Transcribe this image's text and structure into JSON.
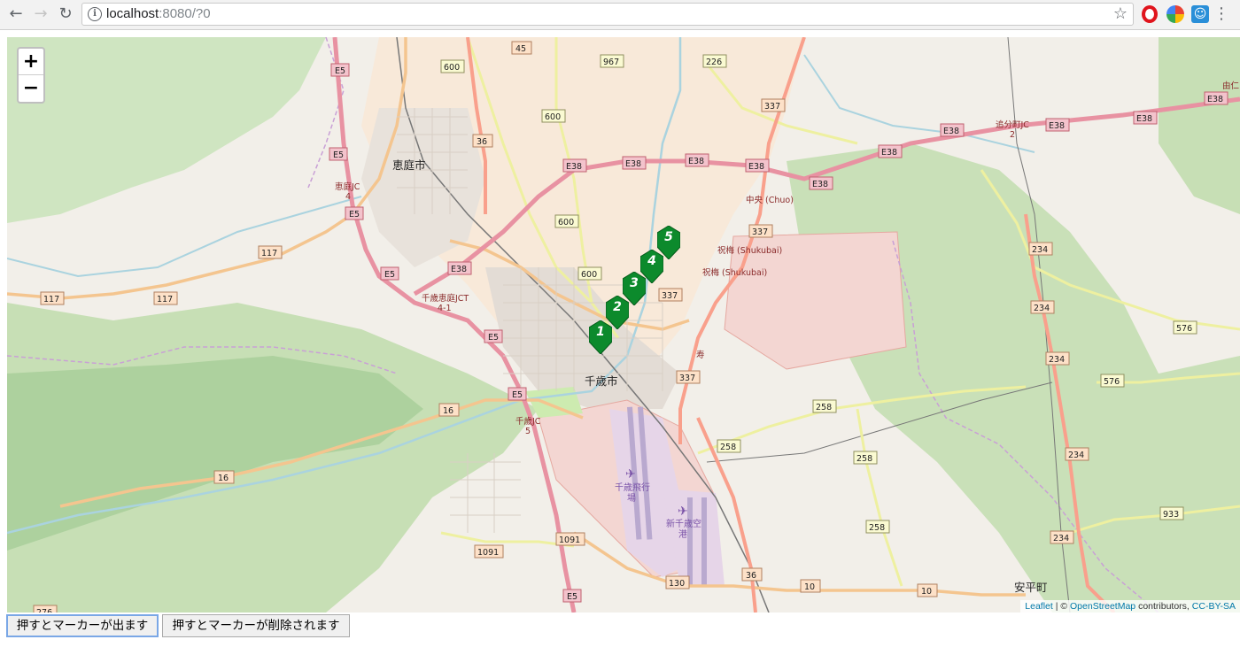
{
  "browser": {
    "url_host": "localhost",
    "url_rest": ":8080/?0",
    "icons": [
      "back-icon",
      "forward-icon",
      "reload-icon",
      "info-icon",
      "star-icon",
      "opera-icon",
      "extension-icon",
      "extension-blue-icon",
      "menu-icon"
    ],
    "back": "←",
    "forward": "→",
    "reload": "↻",
    "info": "i",
    "star": "☆",
    "menu": "⋮",
    "ext_blue": "☺"
  },
  "map": {
    "zoom_in": "+",
    "zoom_out": "−",
    "markers": [
      "1",
      "2",
      "3",
      "4",
      "5"
    ],
    "labels": {
      "eniwa": "恵庭市",
      "chitose": "千歳市",
      "abira": "安平町",
      "chuo": "中央 (Chuo)",
      "shukubai1": "祝梅 (Shukubai)",
      "shukubai2": "祝梅 (Shukubai)",
      "kotobuki": "寿",
      "eniwa_jc_1": "恵庭JC",
      "eniwa_jc_2": "4",
      "chitose_eniwa_jct_1": "千歳恵庭JCT",
      "chitose_eniwa_jct_2": "4-1",
      "chitose_jc_1": "千歳JC",
      "chitose_jc_2": "5",
      "oiwake_jc_1": "追分町JC",
      "oiwake_jc_2": "2",
      "airport1_1": "千歳飛行",
      "airport1_2": "場",
      "airport2_1": "新千歳空",
      "airport2_2": "港",
      "yoshi": "由仁"
    },
    "attribution": {
      "leaflet": "Leaflet",
      "sep": " | © ",
      "osm": "OpenStreetMap",
      "contrib": " contributors, ",
      "license": "CC-BY-SA"
    }
  },
  "buttons": {
    "add": "押すとマーカーが出ます",
    "remove": "押すとマーカーが削除されます"
  },
  "colors": {
    "marker": "#0c8a2c",
    "motorway": "#e892a2",
    "trunk": "#f9b29c",
    "primary": "#fcd6a4",
    "secondary": "#f7fabf",
    "forest": "#add19e",
    "urban": "#f8e9d9",
    "military": "#f3d6d2",
    "water": "#aad3df"
  }
}
